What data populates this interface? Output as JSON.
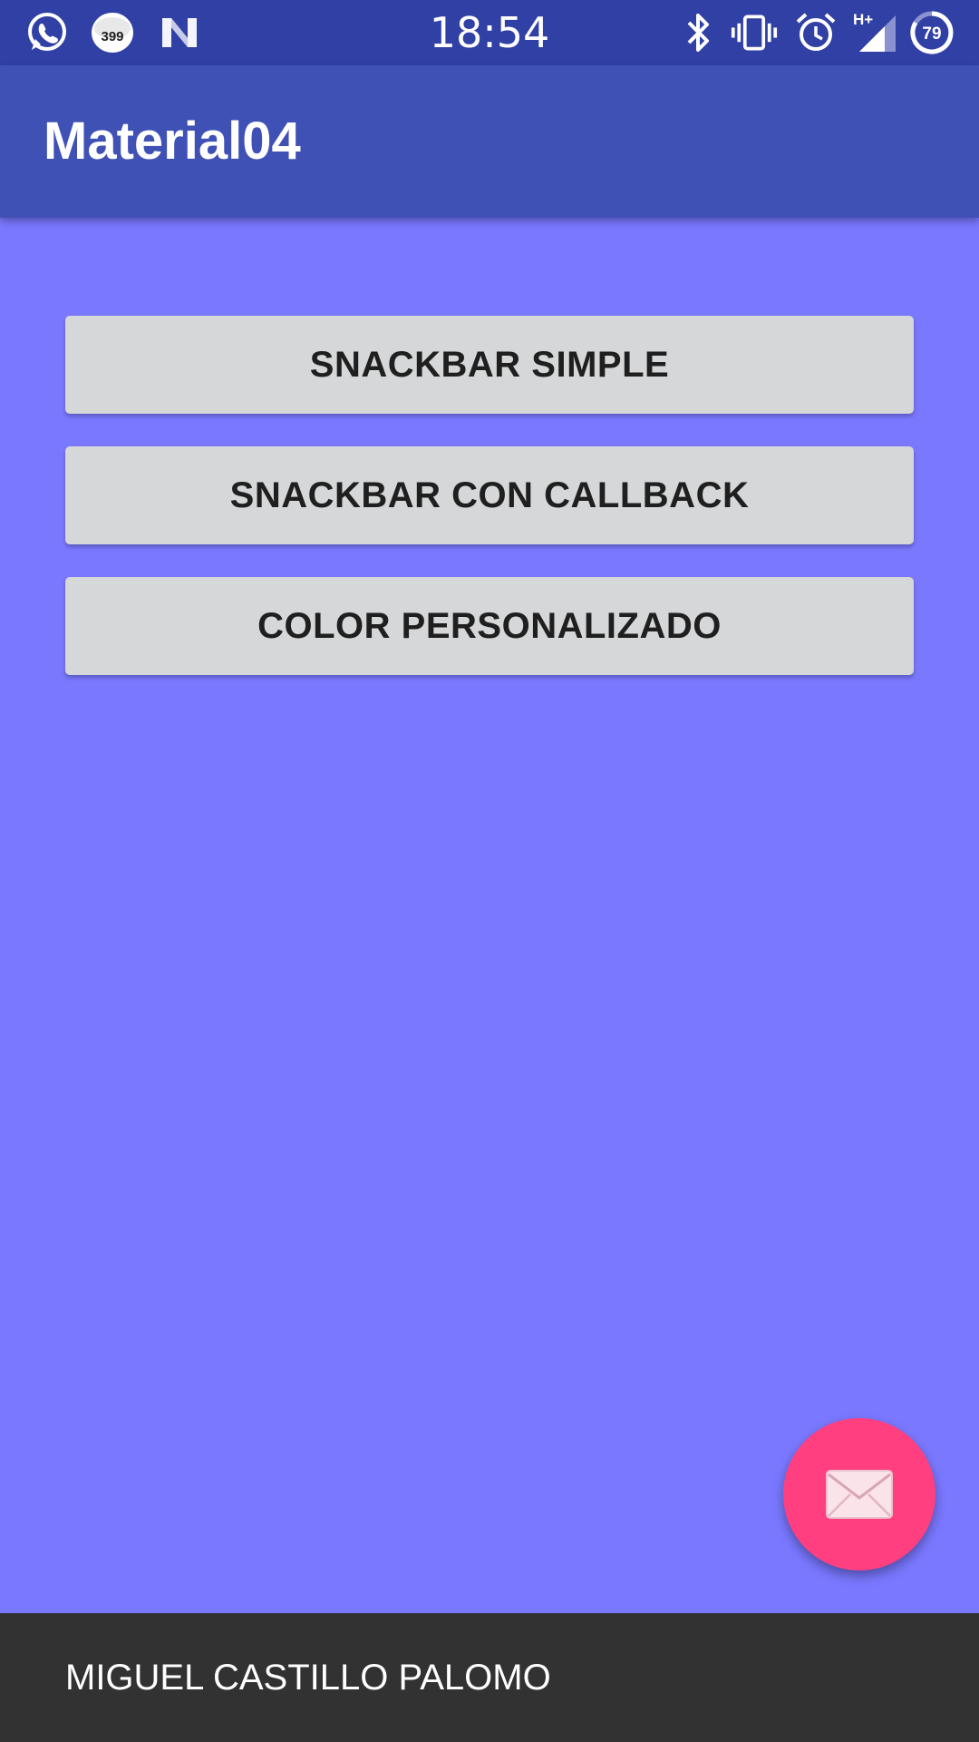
{
  "status_bar": {
    "time": "18:54",
    "notification_badge": "399",
    "battery_level": "79",
    "network_type": "H+",
    "icons_left": [
      "whatsapp-icon",
      "badge-399-icon",
      "n-app-icon"
    ],
    "icons_right": [
      "bluetooth-icon",
      "vibrate-icon",
      "alarm-icon",
      "signal-icon",
      "battery-icon"
    ]
  },
  "app_bar": {
    "title": "Material04"
  },
  "buttons": [
    {
      "label": "SNACKBAR SIMPLE"
    },
    {
      "label": "SNACKBAR CON CALLBACK"
    },
    {
      "label": "COLOR PERSONALIZADO"
    }
  ],
  "fab": {
    "icon": "mail-icon"
  },
  "snackbar": {
    "text": "MIGUEL CASTILLO PALOMO"
  },
  "colors": {
    "status_bar": "#3140a4",
    "app_bar": "#3f51b5",
    "background": "#7a78ff",
    "button": "#d6d7d8",
    "fab": "#ff3f80",
    "snackbar": "#323232"
  }
}
